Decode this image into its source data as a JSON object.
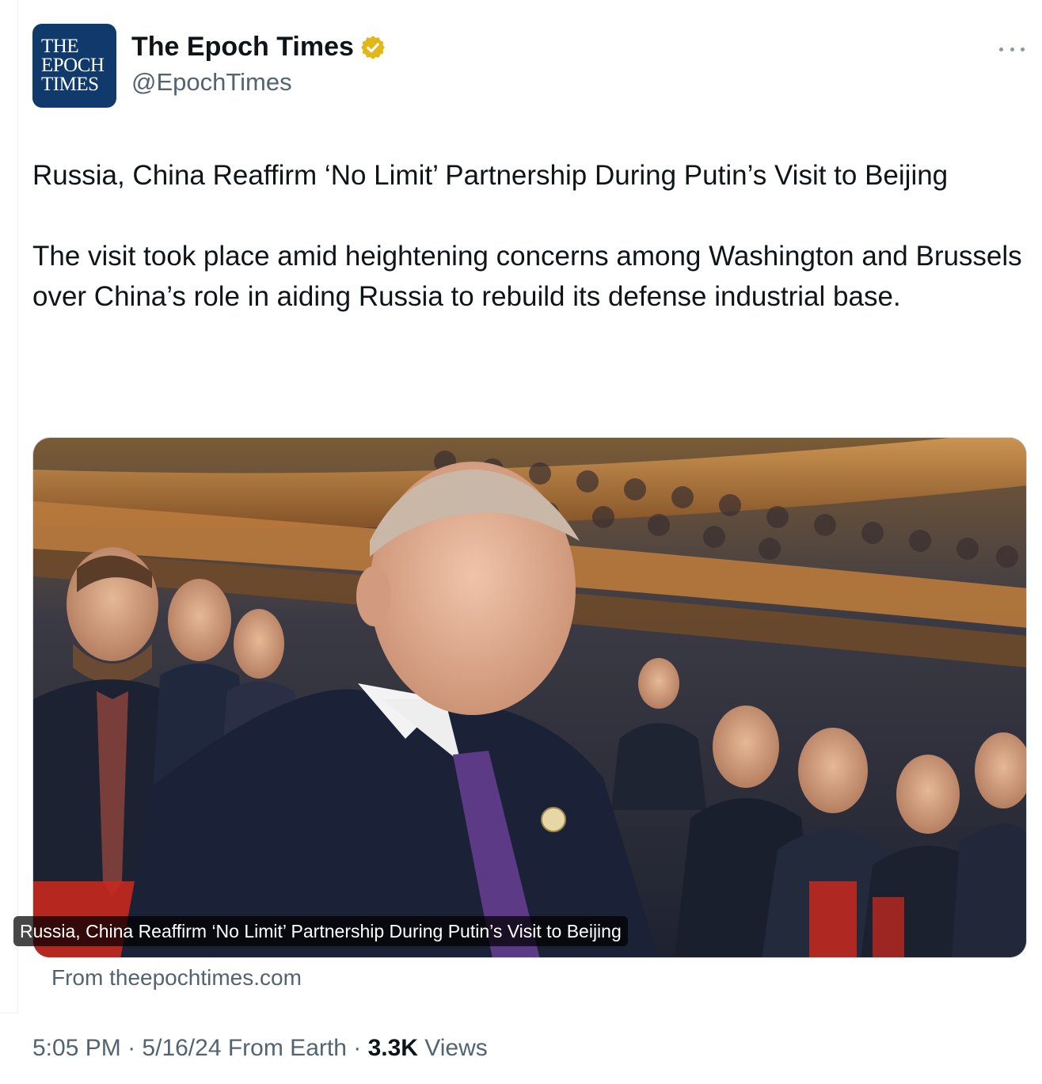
{
  "account": {
    "display_name": "The Epoch Times",
    "handle": "@EpochTimes",
    "avatar_lines": [
      "THE",
      "EPOCH",
      "TIMES"
    ],
    "verified_color": "#e2b719"
  },
  "tweet": {
    "headline": "Russia, China Reaffirm ‘No Limit’ Partnership During Putin’s Visit to Beijing",
    "body": "The visit took place amid heightening concerns among Washington and Brussels over China’s role in aiding Russia to rebuild its defense industrial base."
  },
  "card": {
    "caption": "Russia, China Reaffirm ‘No Limit’ Partnership During Putin’s Visit to Beijing",
    "source": "From theepochtimes.com"
  },
  "meta": {
    "time": "5:05 PM",
    "separator": "·",
    "date": "5/16/24",
    "client": "From Earth",
    "views_count": "3.3K",
    "views_label": "Views"
  },
  "icons": {
    "verified": "verified-badge-icon",
    "more": "more-options-icon"
  }
}
